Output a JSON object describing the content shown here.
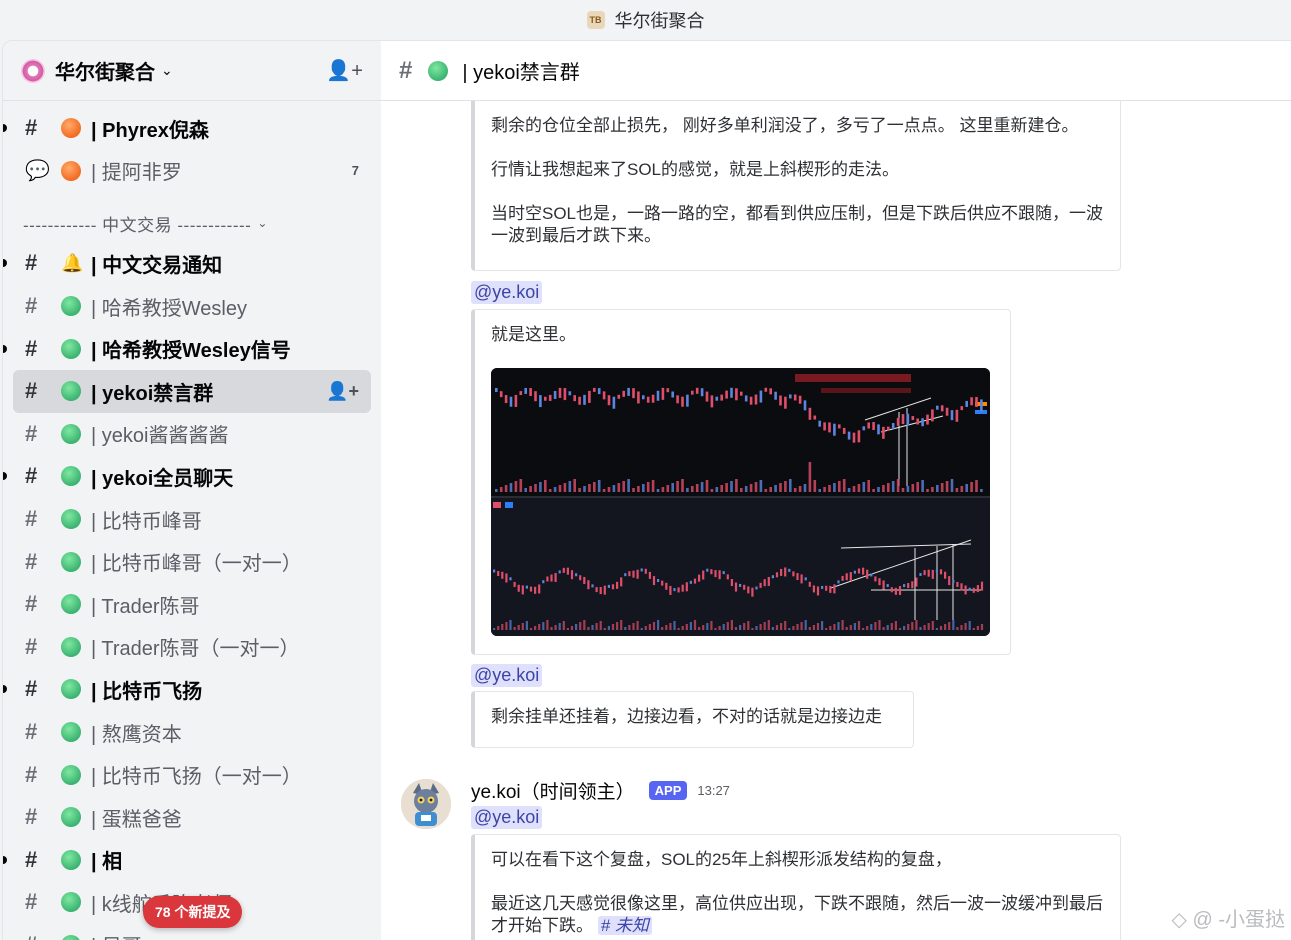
{
  "window": {
    "title": "华尔街聚合"
  },
  "server": {
    "name": "华尔街聚合",
    "invite_icon": "add-user-icon"
  },
  "channels_top": [
    {
      "label": "| Phyrex倪森",
      "dot": "orange",
      "unread": true,
      "type": "text"
    },
    {
      "label": "| 提阿非罗",
      "dot": "orange",
      "unread": false,
      "type": "forum",
      "count": "7"
    }
  ],
  "category": {
    "label": "------------ 中文交易 ------------"
  },
  "channels": [
    {
      "label": "| 中文交易通知",
      "dot": "bell",
      "unread": true
    },
    {
      "label": "| 哈希教授Wesley",
      "dot": "green",
      "unread": false
    },
    {
      "label": "| 哈希教授Wesley信号",
      "dot": "green",
      "unread": true
    },
    {
      "label": "| yekoi禁言群",
      "dot": "green",
      "unread": false,
      "selected": true
    },
    {
      "label": "| yekoi酱酱酱酱",
      "dot": "green",
      "unread": false
    },
    {
      "label": "| yekoi全员聊天",
      "dot": "green",
      "unread": true
    },
    {
      "label": "| 比特币峰哥",
      "dot": "green",
      "unread": false
    },
    {
      "label": "| 比特币峰哥（一对一）",
      "dot": "green",
      "unread": false
    },
    {
      "label": "| Trader陈哥",
      "dot": "green",
      "unread": false
    },
    {
      "label": "| Trader陈哥（一对一）",
      "dot": "green",
      "unread": false
    },
    {
      "label": "| 比特币飞扬",
      "dot": "green",
      "unread": true
    },
    {
      "label": "| 熬鹰资本",
      "dot": "green",
      "unread": false
    },
    {
      "label": "| 比特币飞扬（一对一）",
      "dot": "green",
      "unread": false
    },
    {
      "label": "| 蛋糕爸爸",
      "dot": "green",
      "unread": false
    },
    {
      "label": "| 相",
      "dot": "green",
      "unread": true
    },
    {
      "label": "| k线舵手陈老师",
      "dot": "green",
      "unread": false
    },
    {
      "label": "| 风哥",
      "dot": "green",
      "unread": false
    }
  ],
  "mentions_pill": "78 个新提及",
  "channel_header": {
    "title": "| yekoi禁言群"
  },
  "messages": {
    "m1": {
      "p1": "剩余的仓位全部止损先， 刚好多单利润没了，多亏了一点点。 这里重新建仓。",
      "p2": "行情让我想起来了SOL的感觉，就是上斜楔形的走法。",
      "p3": "当时空SOL也是，一路一路的空，都看到供应压制，但是下跌后供应不跟随，一波一波到最后才跌下来。"
    },
    "mention1": "@ye.koi",
    "m2": {
      "p1": "就是这里。"
    },
    "mention2": "@ye.koi",
    "m3": {
      "p1": "剩余挂单还挂着，边接边看，不对的话就是边接边走"
    },
    "author": {
      "name": "ye.koi（时间领主）",
      "tag": "APP",
      "time": "13:27"
    },
    "mention3": "@ye.koi",
    "m4": {
      "p1": "可以在看下这个复盘，SOL的25年上斜楔形派发结构的复盘，",
      "p2": "最近这几天感觉很像这里，高位供应出现，下跌不跟随，然后一波一波缓冲到最后才开始下跌。",
      "link": "# 未知"
    }
  },
  "watermark": "◇ @ -小蛋挞",
  "colors": {
    "accent": "#5865f2",
    "mention_bg": "#dee0fc",
    "pill": "#da373c",
    "bull": "#e04e6a",
    "bear": "#5a86e0"
  }
}
